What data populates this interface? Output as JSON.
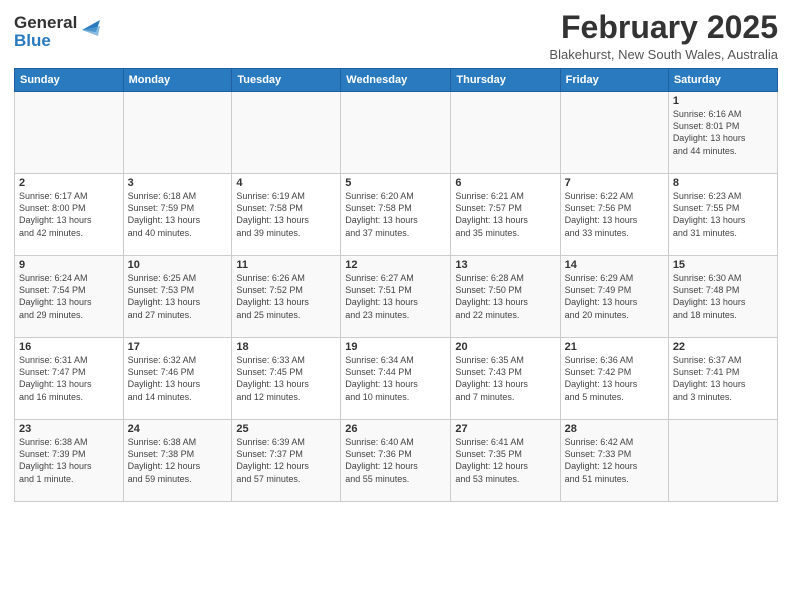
{
  "header": {
    "logo_general": "General",
    "logo_blue": "Blue",
    "month_year": "February 2025",
    "location": "Blakehurst, New South Wales, Australia"
  },
  "weekdays": [
    "Sunday",
    "Monday",
    "Tuesday",
    "Wednesday",
    "Thursday",
    "Friday",
    "Saturday"
  ],
  "weeks": [
    [
      {
        "day": "",
        "info": ""
      },
      {
        "day": "",
        "info": ""
      },
      {
        "day": "",
        "info": ""
      },
      {
        "day": "",
        "info": ""
      },
      {
        "day": "",
        "info": ""
      },
      {
        "day": "",
        "info": ""
      },
      {
        "day": "1",
        "info": "Sunrise: 6:16 AM\nSunset: 8:01 PM\nDaylight: 13 hours\nand 44 minutes."
      }
    ],
    [
      {
        "day": "2",
        "info": "Sunrise: 6:17 AM\nSunset: 8:00 PM\nDaylight: 13 hours\nand 42 minutes."
      },
      {
        "day": "3",
        "info": "Sunrise: 6:18 AM\nSunset: 7:59 PM\nDaylight: 13 hours\nand 40 minutes."
      },
      {
        "day": "4",
        "info": "Sunrise: 6:19 AM\nSunset: 7:58 PM\nDaylight: 13 hours\nand 39 minutes."
      },
      {
        "day": "5",
        "info": "Sunrise: 6:20 AM\nSunset: 7:58 PM\nDaylight: 13 hours\nand 37 minutes."
      },
      {
        "day": "6",
        "info": "Sunrise: 6:21 AM\nSunset: 7:57 PM\nDaylight: 13 hours\nand 35 minutes."
      },
      {
        "day": "7",
        "info": "Sunrise: 6:22 AM\nSunset: 7:56 PM\nDaylight: 13 hours\nand 33 minutes."
      },
      {
        "day": "8",
        "info": "Sunrise: 6:23 AM\nSunset: 7:55 PM\nDaylight: 13 hours\nand 31 minutes."
      }
    ],
    [
      {
        "day": "9",
        "info": "Sunrise: 6:24 AM\nSunset: 7:54 PM\nDaylight: 13 hours\nand 29 minutes."
      },
      {
        "day": "10",
        "info": "Sunrise: 6:25 AM\nSunset: 7:53 PM\nDaylight: 13 hours\nand 27 minutes."
      },
      {
        "day": "11",
        "info": "Sunrise: 6:26 AM\nSunset: 7:52 PM\nDaylight: 13 hours\nand 25 minutes."
      },
      {
        "day": "12",
        "info": "Sunrise: 6:27 AM\nSunset: 7:51 PM\nDaylight: 13 hours\nand 23 minutes."
      },
      {
        "day": "13",
        "info": "Sunrise: 6:28 AM\nSunset: 7:50 PM\nDaylight: 13 hours\nand 22 minutes."
      },
      {
        "day": "14",
        "info": "Sunrise: 6:29 AM\nSunset: 7:49 PM\nDaylight: 13 hours\nand 20 minutes."
      },
      {
        "day": "15",
        "info": "Sunrise: 6:30 AM\nSunset: 7:48 PM\nDaylight: 13 hours\nand 18 minutes."
      }
    ],
    [
      {
        "day": "16",
        "info": "Sunrise: 6:31 AM\nSunset: 7:47 PM\nDaylight: 13 hours\nand 16 minutes."
      },
      {
        "day": "17",
        "info": "Sunrise: 6:32 AM\nSunset: 7:46 PM\nDaylight: 13 hours\nand 14 minutes."
      },
      {
        "day": "18",
        "info": "Sunrise: 6:33 AM\nSunset: 7:45 PM\nDaylight: 13 hours\nand 12 minutes."
      },
      {
        "day": "19",
        "info": "Sunrise: 6:34 AM\nSunset: 7:44 PM\nDaylight: 13 hours\nand 10 minutes."
      },
      {
        "day": "20",
        "info": "Sunrise: 6:35 AM\nSunset: 7:43 PM\nDaylight: 13 hours\nand 7 minutes."
      },
      {
        "day": "21",
        "info": "Sunrise: 6:36 AM\nSunset: 7:42 PM\nDaylight: 13 hours\nand 5 minutes."
      },
      {
        "day": "22",
        "info": "Sunrise: 6:37 AM\nSunset: 7:41 PM\nDaylight: 13 hours\nand 3 minutes."
      }
    ],
    [
      {
        "day": "23",
        "info": "Sunrise: 6:38 AM\nSunset: 7:39 PM\nDaylight: 13 hours\nand 1 minute."
      },
      {
        "day": "24",
        "info": "Sunrise: 6:38 AM\nSunset: 7:38 PM\nDaylight: 12 hours\nand 59 minutes."
      },
      {
        "day": "25",
        "info": "Sunrise: 6:39 AM\nSunset: 7:37 PM\nDaylight: 12 hours\nand 57 minutes."
      },
      {
        "day": "26",
        "info": "Sunrise: 6:40 AM\nSunset: 7:36 PM\nDaylight: 12 hours\nand 55 minutes."
      },
      {
        "day": "27",
        "info": "Sunrise: 6:41 AM\nSunset: 7:35 PM\nDaylight: 12 hours\nand 53 minutes."
      },
      {
        "day": "28",
        "info": "Sunrise: 6:42 AM\nSunset: 7:33 PM\nDaylight: 12 hours\nand 51 minutes."
      },
      {
        "day": "",
        "info": ""
      }
    ]
  ],
  "accent_color": "#2a7abf"
}
